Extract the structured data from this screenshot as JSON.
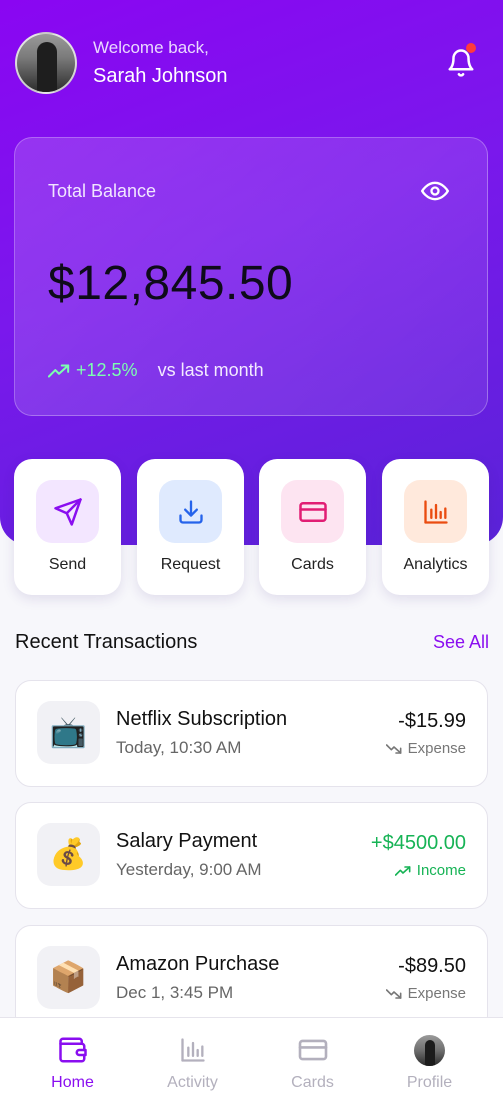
{
  "header": {
    "welcome": "Welcome back,",
    "user_name": "Sarah Johnson"
  },
  "balance": {
    "label": "Total Balance",
    "amount": "$12,845.50",
    "change": "+12.5%",
    "change_note": "vs last month"
  },
  "actions": [
    {
      "label": "Send",
      "icon": "send-icon",
      "bg": "#f3e6ff",
      "color": "#8a0ef0"
    },
    {
      "label": "Request",
      "icon": "download-icon",
      "bg": "#dfeafe",
      "color": "#2563eb"
    },
    {
      "label": "Cards",
      "icon": "card-icon",
      "bg": "#fde4f1",
      "color": "#e11d74"
    },
    {
      "label": "Analytics",
      "icon": "bar-chart-icon",
      "bg": "#ffe9dc",
      "color": "#ea4c10"
    }
  ],
  "transactions_section": {
    "title": "Recent Transactions",
    "see_all": "See All"
  },
  "transactions": [
    {
      "name": "Netflix Subscription",
      "time": "Today, 10:30 AM",
      "amount": "-$15.99",
      "type": "Expense",
      "emoji": "📺"
    },
    {
      "name": "Salary Payment",
      "time": "Yesterday, 9:00 AM",
      "amount": "+$4500.00",
      "type": "Income",
      "emoji": "💰"
    },
    {
      "name": "Amazon Purchase",
      "time": "Dec 1, 3:45 PM",
      "amount": "-$89.50",
      "type": "Expense",
      "emoji": "📦"
    }
  ],
  "nav": [
    {
      "label": "Home",
      "icon": "wallet-icon",
      "active": true
    },
    {
      "label": "Activity",
      "icon": "bar-chart-icon",
      "active": false
    },
    {
      "label": "Cards",
      "icon": "card-icon",
      "active": false
    },
    {
      "label": "Profile",
      "icon": "avatar",
      "active": false
    }
  ],
  "colors": {
    "brand": "#8a0ef0",
    "income": "#16b355",
    "notification_dot": "#ff3b3b"
  }
}
